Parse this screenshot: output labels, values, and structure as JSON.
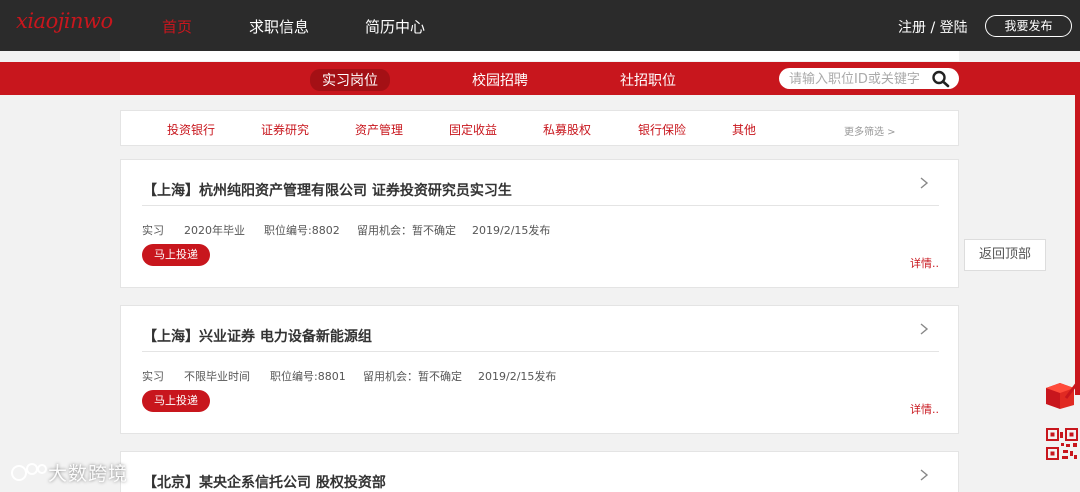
{
  "header": {
    "logo_text": "xiaojinwo",
    "nav": [
      "首页",
      "求职信息",
      "简历中心"
    ],
    "auth": "注册 / 登陆",
    "publish": "我要发布"
  },
  "subnav": {
    "tabs": [
      "实习岗位",
      "校园招聘",
      "社招职位"
    ],
    "search_placeholder": "请输入职位ID或关键字"
  },
  "filters": {
    "items": [
      "投资银行",
      "证券研究",
      "资产管理",
      "固定收益",
      "私募股权",
      "银行保险",
      "其他"
    ],
    "more": "更多筛选 >"
  },
  "jobs": [
    {
      "title": "【上海】杭州纯阳资产管理有限公司 证券投资研究员实习生",
      "type": "实习",
      "grad": "2020年毕业",
      "job_id": "职位编号:8802",
      "retention": "留用机会：暂不确定",
      "date": "2019/2/15发布",
      "apply": "马上投递",
      "detail": "详情.."
    },
    {
      "title": "【上海】兴业证券 电力设备新能源组",
      "type": "实习",
      "grad": "不限毕业时间",
      "job_id": "职位编号:8801",
      "retention": "留用机会：暂不确定",
      "date": "2019/2/15发布",
      "apply": "马上投递",
      "detail": "详情.."
    },
    {
      "title": "【北京】某央企系信托公司 股权投资部"
    }
  ],
  "side": {
    "back_top": "返回顶部"
  },
  "watermark": "大数跨境",
  "colors": {
    "brand_red": "#c8161d",
    "header_bg": "#2b2b2b"
  }
}
